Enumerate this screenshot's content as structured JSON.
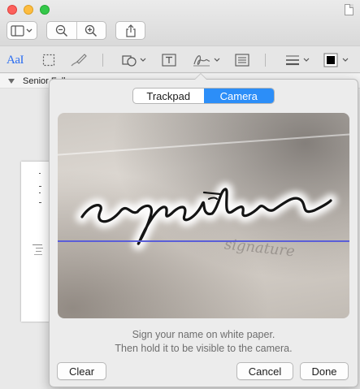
{
  "window": {
    "document_row_label": "Senior Fellow"
  },
  "popover": {
    "tabs": [
      {
        "label": "Trackpad",
        "active": false
      },
      {
        "label": "Camera",
        "active": true
      }
    ],
    "camera_signature_text": "signature",
    "instructions_line1": "Sign your name on white paper.",
    "instructions_line2": "Then hold it to be visible to the camera.",
    "clear_label": "Clear",
    "cancel_label": "Cancel",
    "done_label": "Done"
  },
  "markup_toolbar": {
    "text_style_label": "AaI"
  },
  "colors": {
    "accent": "#2c8ef8",
    "baseline": "#5a5ed8",
    "close": "#fc605c",
    "minimize": "#fdbc40",
    "maximize": "#34c84a"
  }
}
